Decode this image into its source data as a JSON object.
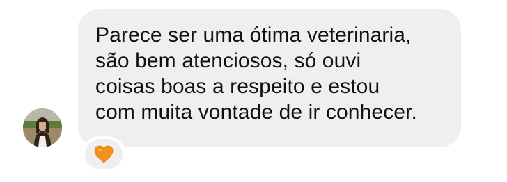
{
  "message": {
    "lines": [
      "Parece ser uma ótima veterinaria,",
      "são bem atenciosos, só ouvi",
      "coisas boas a respeito e estou",
      "com muita vontade de ir conhecer."
    ]
  },
  "reaction": {
    "icon": "orange-heart-icon",
    "color": "#f5901a"
  },
  "avatar": {
    "icon": "user-avatar"
  }
}
